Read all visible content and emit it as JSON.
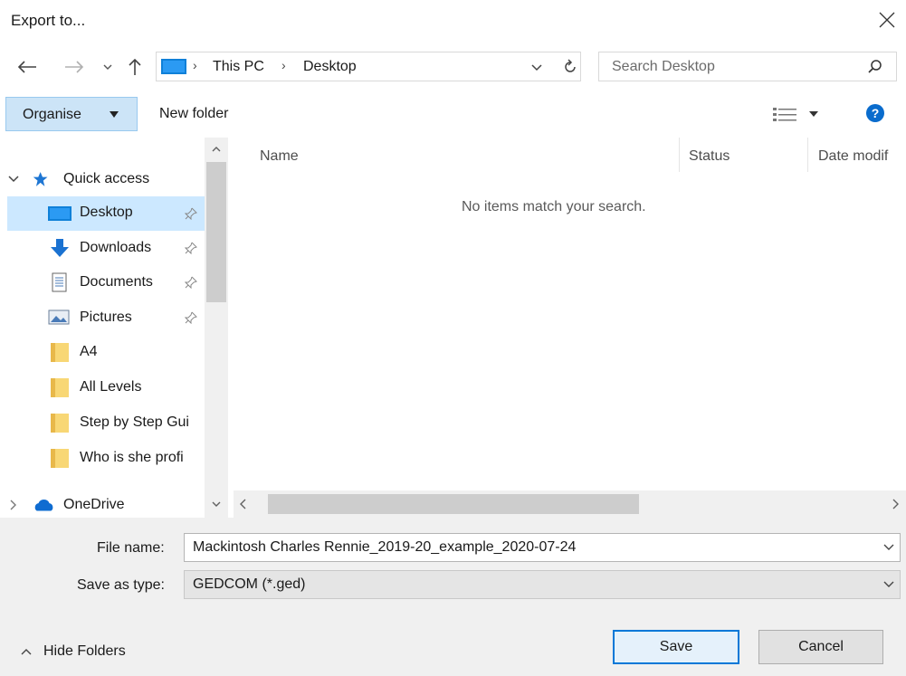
{
  "window": {
    "title": "Export to..."
  },
  "address": {
    "crumbs": [
      "This PC",
      "Desktop"
    ]
  },
  "search": {
    "placeholder": "Search Desktop"
  },
  "toolbar": {
    "organise_label": "Organise",
    "new_folder_label": "New folder"
  },
  "tree": {
    "quick_access": "Quick access",
    "items": [
      {
        "label": "Desktop",
        "icon": "desktop-icon",
        "pinned": true,
        "selected": true
      },
      {
        "label": "Downloads",
        "icon": "download-icon",
        "pinned": true
      },
      {
        "label": "Documents",
        "icon": "document-icon",
        "pinned": true
      },
      {
        "label": "Pictures",
        "icon": "pictures-icon",
        "pinned": true
      },
      {
        "label": "A4",
        "icon": "folder-icon"
      },
      {
        "label": "All Levels",
        "icon": "folder-icon"
      },
      {
        "label": "Step by Step Gui",
        "icon": "folder-icon"
      },
      {
        "label": "Who is she profi",
        "icon": "folder-icon"
      }
    ],
    "onedrive": "OneDrive"
  },
  "list": {
    "columns": [
      "Name",
      "Status",
      "Date modif"
    ],
    "empty_message": "No items match your search."
  },
  "form": {
    "filename_label": "File name:",
    "filename_value": "Mackintosh Charles Rennie_2019-20_example_2020-07-24",
    "type_label": "Save as type:",
    "type_value": "GEDCOM (*.ged)"
  },
  "buttons": {
    "save": "Save",
    "cancel": "Cancel",
    "hide_folders": "Hide Folders"
  },
  "colors": {
    "accent": "#0078d7",
    "selection": "#cce8ff",
    "folder": "#f8d775"
  }
}
